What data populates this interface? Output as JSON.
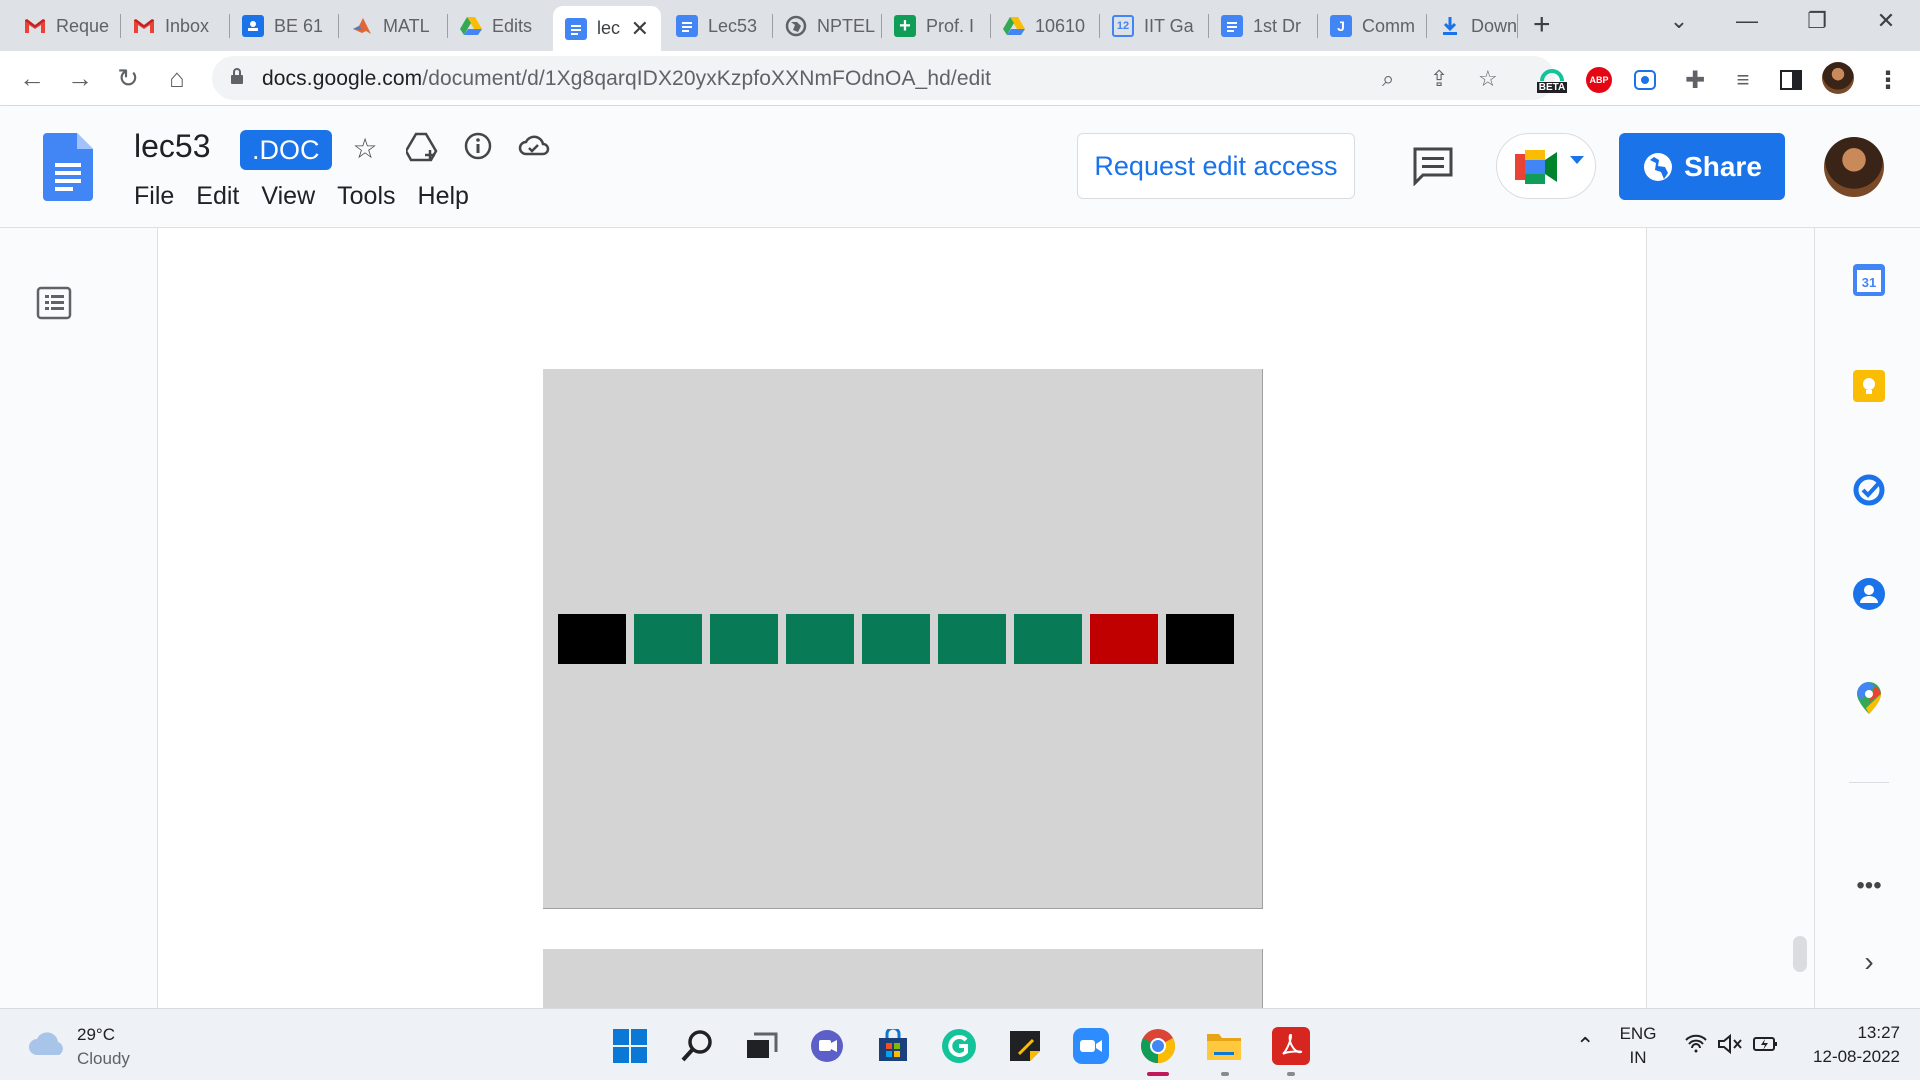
{
  "browser": {
    "tabs": [
      {
        "label": "Reque",
        "icon": "gmail-icon"
      },
      {
        "label": "Inbox",
        "icon": "gmail-icon"
      },
      {
        "label": "BE 61",
        "icon": "classroom-icon"
      },
      {
        "label": "MATL",
        "icon": "matlab-icon"
      },
      {
        "label": "Edits",
        "icon": "drive-icon"
      },
      {
        "label": "lec",
        "icon": "docs-icon",
        "active": true
      },
      {
        "label": "Lec53",
        "icon": "docs-icon"
      },
      {
        "label": "NPTEL",
        "icon": "globe-icon"
      },
      {
        "label": "Prof. I",
        "icon": "sheets-plus-icon"
      },
      {
        "label": "10610",
        "icon": "drive-icon"
      },
      {
        "label": "IIT Ga",
        "icon": "calendar-icon"
      },
      {
        "label": "1st Dr",
        "icon": "docs-icon"
      },
      {
        "label": "Comm",
        "icon": "jamboard-icon"
      },
      {
        "label": "Down",
        "icon": "download-icon"
      }
    ],
    "url_host": "docs.google.com",
    "url_path": "/document/d/1Xg8qarqIDX20yxKzpfoXXNmFOdnOA_hd/edit",
    "extension_badge": "BETA",
    "abp_label": "ABP"
  },
  "doc": {
    "title": "lec53",
    "badge": ".DOC",
    "menu": [
      "File",
      "Edit",
      "View",
      "Tools",
      "Help"
    ],
    "request_edit_label": "Request edit access",
    "share_label": "Share"
  },
  "figure": {
    "cells": [
      "black",
      "green",
      "green",
      "green",
      "green",
      "green",
      "green",
      "red",
      "black"
    ],
    "colors": {
      "black": "#000000",
      "green": "#087a56",
      "red": "#c00000",
      "slide_bg": "#d4d4d4"
    }
  },
  "taskbar": {
    "weather_temp": "29°C",
    "weather_cond": "Cloudy",
    "lang_top": "ENG",
    "lang_bottom": "IN",
    "time": "13:27",
    "date": "12-08-2022"
  },
  "side_panel": [
    "calendar-icon",
    "keep-icon",
    "tasks-icon",
    "contacts-icon",
    "maps-icon"
  ],
  "accent": "#1a73e8"
}
